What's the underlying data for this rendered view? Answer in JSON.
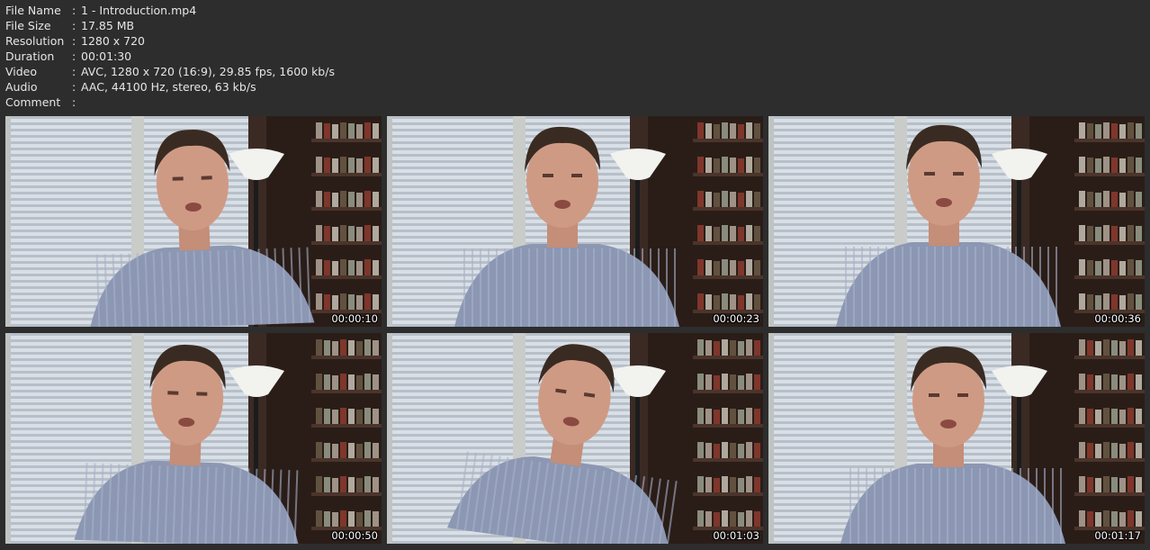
{
  "info": {
    "rows": [
      {
        "label": "File Name",
        "value": "1 - Introduction.mp4"
      },
      {
        "label": "File Size",
        "value": "17.85 MB"
      },
      {
        "label": "Resolution",
        "value": "1280 x 720"
      },
      {
        "label": "Duration",
        "value": "00:01:30"
      },
      {
        "label": "Video",
        "value": "AVC, 1280 x 720 (16:9), 29.85 fps, 1600 kb/s"
      },
      {
        "label": "Audio",
        "value": "AAC, 44100 Hz, stereo, 63 kb/s"
      },
      {
        "label": "Comment",
        "value": ""
      }
    ],
    "separator": ":"
  },
  "thumbnails": [
    {
      "timestamp": "00:00:10"
    },
    {
      "timestamp": "00:00:23"
    },
    {
      "timestamp": "00:00:36"
    },
    {
      "timestamp": "00:00:50"
    },
    {
      "timestamp": "00:01:03"
    },
    {
      "timestamp": "00:01:17"
    }
  ],
  "colors": {
    "background": "#2d2d2d",
    "text": "#e6e6e6",
    "timestamp_text": "#ffffff"
  }
}
